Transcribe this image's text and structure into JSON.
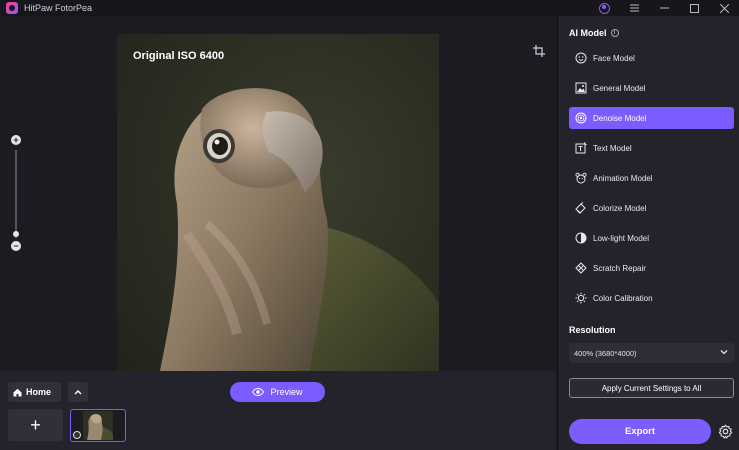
{
  "titlebar": {
    "app_title": "HitPaw FotorPea",
    "icons": [
      "user-icon",
      "menu-icon",
      "minimize-icon",
      "maximize-icon",
      "close-icon"
    ]
  },
  "canvas": {
    "photo_label": "Original ISO 6400",
    "tool_icon": "crop-icon"
  },
  "zoom": {
    "plus_label": "+",
    "minus_label": "−",
    "level": 0.05
  },
  "bottom": {
    "home_label": "Home",
    "preview_label": "Preview",
    "add_label": "+"
  },
  "panel": {
    "ai_model_title": "AI Model",
    "models": [
      {
        "label": "Face Model",
        "icon": "face-icon",
        "active": false
      },
      {
        "label": "General Model",
        "icon": "image-icon",
        "active": false
      },
      {
        "label": "Denoise Model",
        "icon": "denoise-icon",
        "active": true
      },
      {
        "label": "Text Model",
        "icon": "text-icon",
        "active": false
      },
      {
        "label": "Animation Model",
        "icon": "animation-icon",
        "active": false
      },
      {
        "label": "Colorize Model",
        "icon": "colorize-icon",
        "active": false
      },
      {
        "label": "Low-light Model",
        "icon": "low-light-icon",
        "active": false
      },
      {
        "label": "Scratch Repair",
        "icon": "scratch-repair-icon",
        "active": false
      },
      {
        "label": "Color Calibration",
        "icon": "color-calibration-icon",
        "active": false
      }
    ],
    "resolution_title": "Resolution",
    "resolution_value": "400% (3680*4000)",
    "apply_label": "Apply Current Settings to All",
    "export_label": "Export"
  },
  "colors": {
    "accent": "#7b5cff",
    "background": "#1b1b22",
    "panel": "#23232b"
  }
}
